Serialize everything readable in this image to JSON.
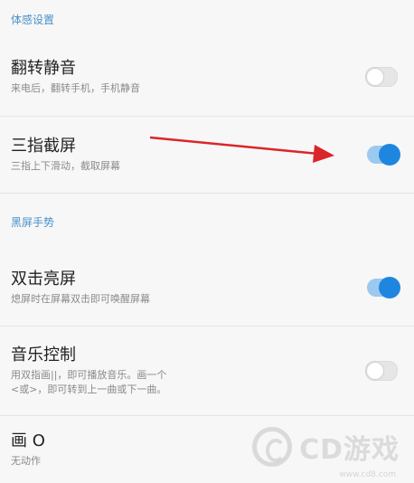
{
  "sections": {
    "motion": {
      "title": "体感设置"
    },
    "blackscreen": {
      "title": "黑屏手势"
    }
  },
  "settings": {
    "flip_mute": {
      "title": "翻转静音",
      "desc": "来电后，翻转手机，手机静音",
      "enabled": false
    },
    "three_finger_screenshot": {
      "title": "三指截屏",
      "desc": "三指上下滑动，截取屏幕",
      "enabled": true
    },
    "double_tap_wake": {
      "title": "双击亮屏",
      "desc": "熄屏时在屏幕双击即可唤醒屏幕",
      "enabled": true
    },
    "music_control": {
      "title": "音乐控制",
      "desc_line1": "用双指画||，即可播放音乐。画一个",
      "desc_line2": "<或>，即可转到上一曲或下一曲。",
      "enabled": false
    },
    "draw_o": {
      "title": "画 O",
      "desc": "无动作"
    }
  },
  "watermark": {
    "brand": "CD游戏",
    "url": "www.cd8.com"
  },
  "colors": {
    "accent": "#1f86e0",
    "section_header": "#4a90c8",
    "arrow": "#d9262b"
  }
}
